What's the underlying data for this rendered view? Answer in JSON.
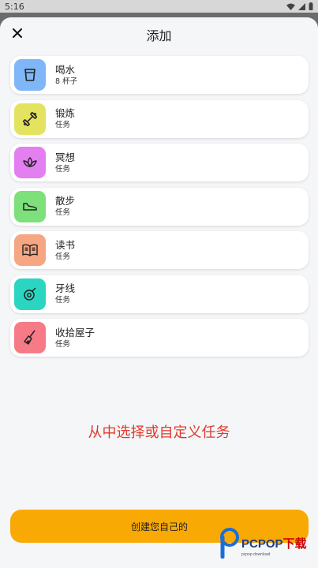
{
  "status_bar": {
    "time": "5:16"
  },
  "header": {
    "title": "添加"
  },
  "items": [
    {
      "name": "喝水",
      "subtitle": "8 杯子",
      "icon": "cup-icon",
      "color": "#7fb6f7"
    },
    {
      "name": "锻炼",
      "subtitle": "任务",
      "icon": "dumbbell-icon",
      "color": "#e4e35f"
    },
    {
      "name": "冥想",
      "subtitle": "任务",
      "icon": "lotus-icon",
      "color": "#e37ff0"
    },
    {
      "name": "散步",
      "subtitle": "任务",
      "icon": "shoe-icon",
      "color": "#7ee07b"
    },
    {
      "name": "读书",
      "subtitle": "任务",
      "icon": "book-icon",
      "color": "#f6a683"
    },
    {
      "name": "牙线",
      "subtitle": "任务",
      "icon": "floss-icon",
      "color": "#2ad6c1"
    },
    {
      "name": "收拾屋子",
      "subtitle": "任务",
      "icon": "broom-icon",
      "color": "#f67b86"
    }
  ],
  "promo_text": "从中选择或自定义任务",
  "create_button": {
    "label": "创建您自己的"
  },
  "watermark": {
    "main": "PCPOP",
    "accent": "下载",
    "sub": "pcpop download"
  },
  "colors": {
    "accent": "#f9a904",
    "promo": "#e03a2c"
  }
}
